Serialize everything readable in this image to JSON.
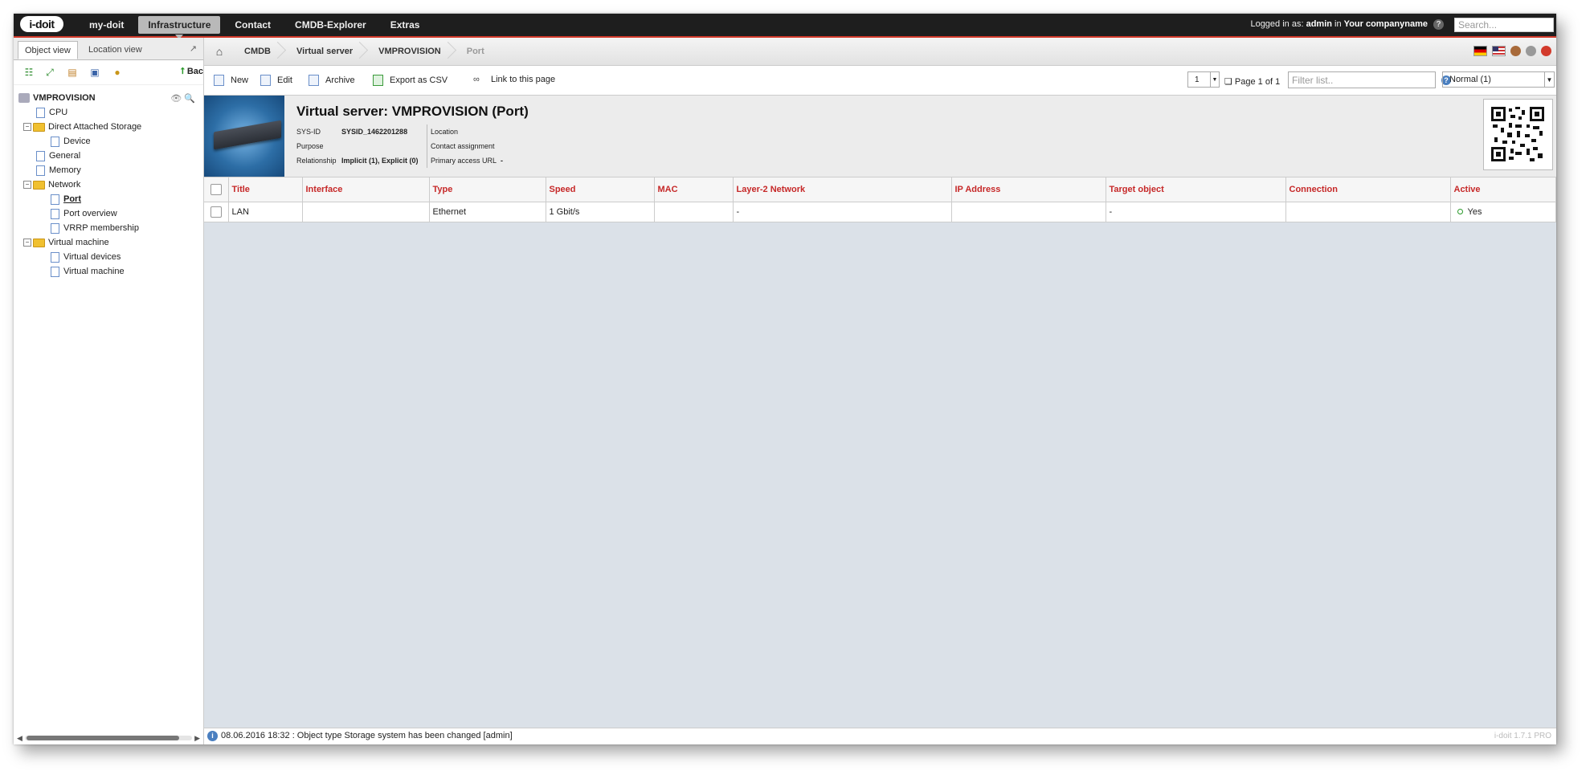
{
  "app": {
    "logo_text": "i-doit",
    "nav": [
      "my-doit",
      "Infrastructure",
      "Contact",
      "CMDB-Explorer",
      "Extras"
    ],
    "login_prefix": "Logged in as:",
    "login_user": "admin",
    "login_in": "in",
    "login_company": "Your companyname",
    "help_icon": "?",
    "search_placeholder": "Search..."
  },
  "left": {
    "tabs": [
      "Object view",
      "Location view"
    ],
    "back_label": "Bac",
    "tree": {
      "root": "VMPROVISION",
      "items": [
        {
          "label": "CPU"
        },
        {
          "label": "Direct Attached Storage"
        },
        {
          "label": "Device"
        },
        {
          "label": "General"
        },
        {
          "label": "Memory"
        },
        {
          "label": "Network"
        },
        {
          "label": "Port"
        },
        {
          "label": "Port overview"
        },
        {
          "label": "VRRP membership"
        },
        {
          "label": "Virtual machine"
        },
        {
          "label": "Virtual devices"
        },
        {
          "label": "Virtual machine"
        }
      ]
    }
  },
  "breadcrumb": [
    "CMDB",
    "Virtual server",
    "VMPROVISION",
    "Port"
  ],
  "actions": {
    "new": "New",
    "edit": "Edit",
    "archive": "Archive",
    "export": "Export as CSV",
    "link": "Link to this page",
    "page_select": "1",
    "page_info": "Page 1 of 1",
    "filter_placeholder": "Filter list..",
    "mode": "Normal (1)"
  },
  "object": {
    "title": "Virtual server: VMPROVISION (Port)",
    "sysid_label": "SYS-ID",
    "sysid_value": "SYSID_1462201288",
    "purpose_label": "Purpose",
    "relationship_label": "Relationship",
    "relationship_value": "Implicit (1), Explicit (0)",
    "location_label": "Location",
    "contact_label": "Contact assignment",
    "access_label": "Primary access URL",
    "access_value": "-"
  },
  "table": {
    "columns": [
      "Title",
      "Interface",
      "Type",
      "Speed",
      "MAC",
      "Layer-2 Network",
      "IP Address",
      "Target object",
      "Connection",
      "Active"
    ],
    "rows": [
      [
        "LAN",
        "",
        "Ethernet",
        "1 Gbit/s",
        "",
        "-",
        "",
        "-",
        "",
        "Yes"
      ]
    ]
  },
  "status": {
    "message": "08.06.2016 18:32 : Object type Storage system has been changed [admin]",
    "version": "i-doit 1.7.1 PRO"
  },
  "colors": {
    "accent_red": "#c62828",
    "topbar": "#1e1e1e",
    "active_green": "#2a9a2a"
  }
}
